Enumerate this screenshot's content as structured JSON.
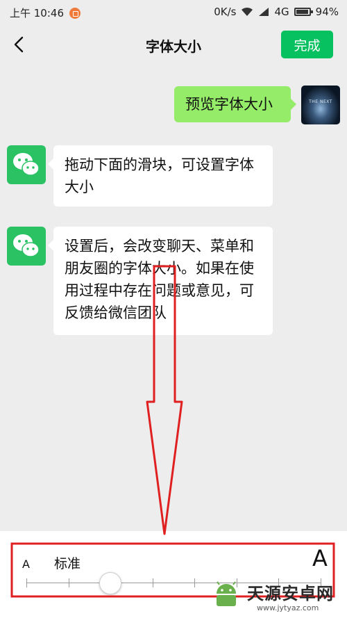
{
  "status_bar": {
    "time": "上午 10:46",
    "network_speed": "0K/s",
    "network_type": "4G",
    "battery": "94%"
  },
  "title_bar": {
    "title": "字体大小",
    "done_label": "完成",
    "back_icon": "chevron-left-icon"
  },
  "messages": [
    {
      "side": "right",
      "text": "预览字体大小",
      "avatar": "user-avatar"
    },
    {
      "side": "left",
      "lines": [
        "拖动下面的滑块，可设置字体",
        "大小"
      ],
      "avatar": "wechat-logo-icon"
    },
    {
      "side": "left",
      "lines": [
        "设置后，会改变聊天、菜单和",
        "朋友圈的字体大小。如果在使",
        "用过程中存在问题或意见，可",
        "反馈给微信团队"
      ],
      "avatar": "wechat-logo-icon"
    }
  ],
  "avatar_user_text": "THE NEXT",
  "font_size": {
    "small_label": "A",
    "large_label": "A",
    "current_level": "标准",
    "levels": 8,
    "selected_index": 2
  },
  "watermark": {
    "brand": "天源安卓网",
    "url": "www.jytyaz.com"
  },
  "colors": {
    "accent": "#07c160",
    "my_bubble": "#95ec69",
    "annotation": "#e02020"
  }
}
